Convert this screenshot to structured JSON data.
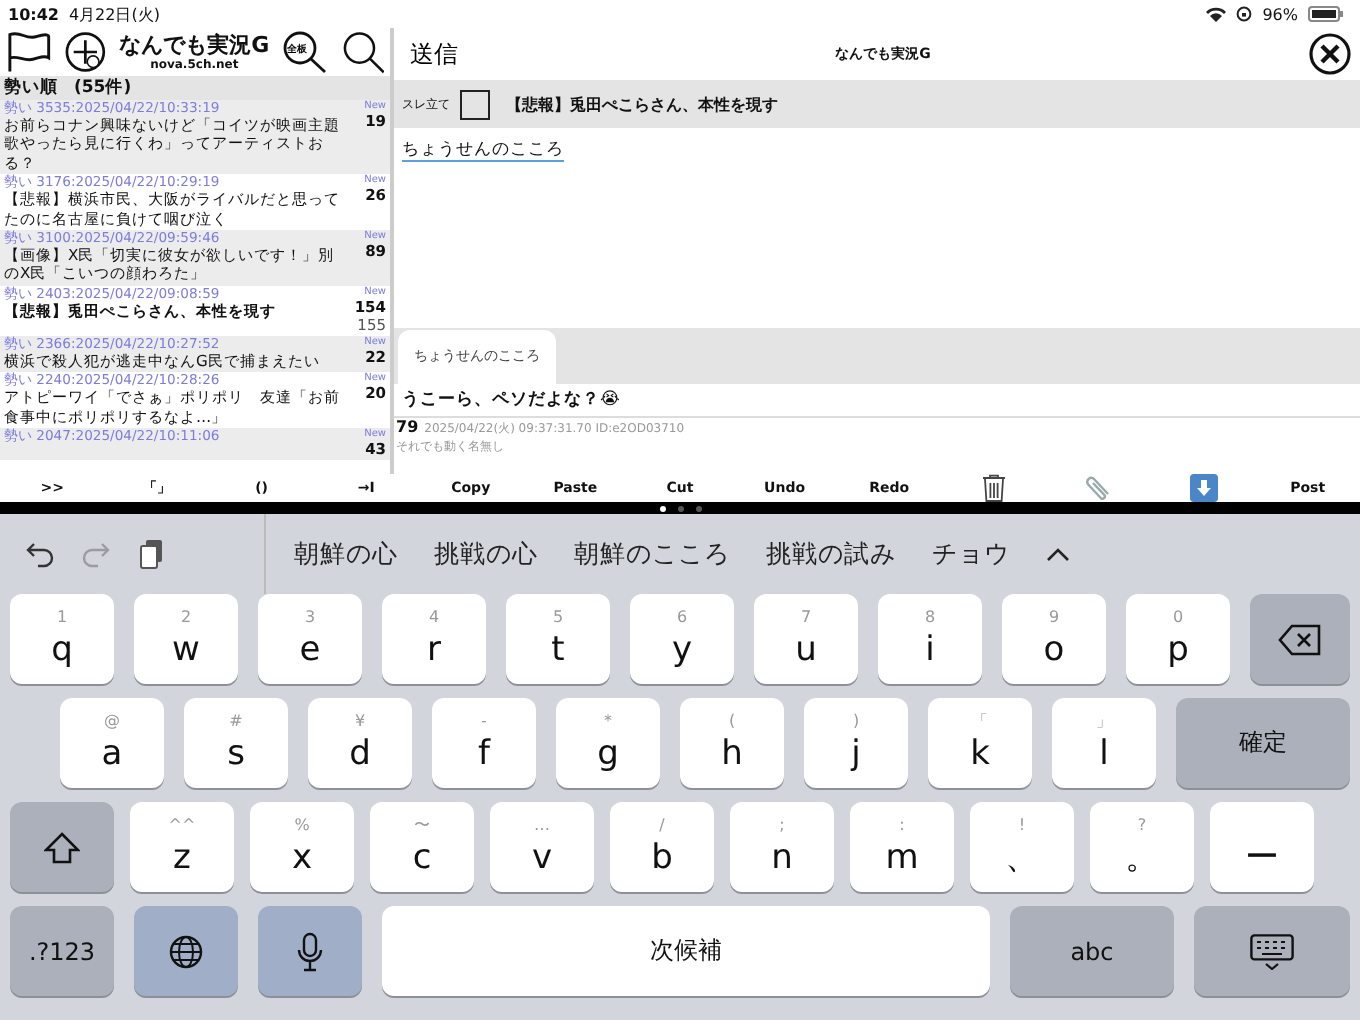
{
  "status_bar": {
    "time": "10:42",
    "date": "4月22日(火)",
    "battery": "96%"
  },
  "thread_list": {
    "board_title": "なんでも実況G",
    "board_host": "nova.5ch.net",
    "search_label": "全板",
    "sort_label": "勢い順",
    "count": "(55件)",
    "threads": [
      {
        "meta": "勢い 3535:2025/04/22/10:33:19",
        "title": "お前らコナン興味ないけど「コイツが映画主題歌やったら見に行くわ」ってアーティストおる？",
        "new_label": "New",
        "count": "19",
        "selected": false
      },
      {
        "meta": "勢い 3176:2025/04/22/10:29:19",
        "title": "【悲報】横浜市民、大阪がライバルだと思ってたのに名古屋に負けて咽び泣く",
        "new_label": "New",
        "count": "26",
        "selected": false
      },
      {
        "meta": "勢い 3100:2025/04/22/09:59:46",
        "title": "【画像】X民「切実に彼女が欲しいです！」別のX民「こいつの顔わろた」",
        "new_label": "New",
        "count": "89",
        "selected": false
      },
      {
        "meta": "勢い 2403:2025/04/22/09:08:59",
        "title": "【悲報】兎田ぺこらさん、本性を現す",
        "new_label": "New",
        "count": "154",
        "total": "155",
        "selected": true
      },
      {
        "meta": "勢い 2366:2025/04/22/10:27:52",
        "title": "横浜で殺人犯が逃走中なんG民で捕まえたい",
        "new_label": "New",
        "count": "22",
        "selected": false
      },
      {
        "meta": "勢い 2240:2025/04/22/10:28:26",
        "title": "アトピーワイ「でさぁ」ポリポリ　友達「お前食事中にポリポリするなよ…」",
        "new_label": "New",
        "count": "20",
        "selected": false
      },
      {
        "meta": "勢い 2047:2025/04/22/10:11:06",
        "new_label": "New",
        "count": "43",
        "selected": false
      }
    ]
  },
  "compose": {
    "send_label": "送信",
    "title": "なんでも実況G",
    "new_thread_label": "スレ立て",
    "new_thread_checked": false,
    "subject": "【悲報】兎田ぺこらさん、本性を現す",
    "body": "ちょうせんのこころ",
    "tab": "ちょうせんのこころ",
    "quote": "うこーら、ペソだよな？😭",
    "post_number": "79",
    "post_meta": "2025/04/22(火) 09:37:31.70 ID:e2OD03710",
    "post_name": "それでも動く名無し"
  },
  "toolbar": [
    {
      "kind": "text",
      "label": ">>"
    },
    {
      "kind": "text",
      "label": "「」"
    },
    {
      "kind": "text",
      "label": "()"
    },
    {
      "kind": "text",
      "label": "→I"
    },
    {
      "kind": "text",
      "label": "Copy"
    },
    {
      "kind": "text",
      "label": "Paste"
    },
    {
      "kind": "text",
      "label": "Cut"
    },
    {
      "kind": "text",
      "label": "Undo"
    },
    {
      "kind": "text",
      "label": "Redo"
    },
    {
      "kind": "trash"
    },
    {
      "kind": "clip"
    },
    {
      "kind": "download"
    },
    {
      "kind": "text",
      "label": "Post"
    }
  ],
  "page_dots": [
    {
      "selected": true
    },
    {
      "selected": false
    },
    {
      "selected": false
    }
  ],
  "keyboard": {
    "tools": [
      {
        "kind": "undo",
        "disabled": false
      },
      {
        "kind": "redo",
        "disabled": true
      },
      {
        "kind": "paste",
        "disabled": false
      }
    ],
    "candidates": [
      "朝鮮の心",
      "挑戦の心",
      "朝鮮のこころ",
      "挑戦の試み",
      "チョウ"
    ],
    "rows": [
      {
        "keys": [
          {
            "kind": "char",
            "label": "q",
            "hint": "1"
          },
          {
            "kind": "char",
            "label": "w",
            "hint": "2"
          },
          {
            "kind": "char",
            "label": "e",
            "hint": "3"
          },
          {
            "kind": "char",
            "label": "r",
            "hint": "4"
          },
          {
            "kind": "char",
            "label": "t",
            "hint": "5"
          },
          {
            "kind": "char",
            "label": "y",
            "hint": "6"
          },
          {
            "kind": "char",
            "label": "u",
            "hint": "7"
          },
          {
            "kind": "char",
            "label": "i",
            "hint": "8"
          },
          {
            "kind": "char",
            "label": "o",
            "hint": "9"
          },
          {
            "kind": "char",
            "label": "p",
            "hint": "0"
          },
          {
            "kind": "backspace"
          }
        ]
      },
      {
        "keys": [
          {
            "kind": "char",
            "label": "a",
            "hint": "@"
          },
          {
            "kind": "char",
            "label": "s",
            "hint": "#"
          },
          {
            "kind": "char",
            "label": "d",
            "hint": "¥"
          },
          {
            "kind": "char",
            "label": "f",
            "hint": "-"
          },
          {
            "kind": "char",
            "label": "g",
            "hint": "*"
          },
          {
            "kind": "char",
            "label": "h",
            "hint": "("
          },
          {
            "kind": "char",
            "label": "j",
            "hint": ")"
          },
          {
            "kind": "char",
            "label": "k",
            "hint": "「"
          },
          {
            "kind": "char",
            "label": "l",
            "hint": "」"
          },
          {
            "kind": "text",
            "label": "確定"
          }
        ]
      },
      {
        "keys": [
          {
            "kind": "shift"
          },
          {
            "kind": "char",
            "label": "z",
            "hint": "^^"
          },
          {
            "kind": "char",
            "label": "x",
            "hint": "%"
          },
          {
            "kind": "char",
            "label": "c",
            "hint": "〜"
          },
          {
            "kind": "char",
            "label": "v",
            "hint": "…"
          },
          {
            "kind": "char",
            "label": "b",
            "hint": "/"
          },
          {
            "kind": "char",
            "label": "n",
            "hint": ";"
          },
          {
            "kind": "char",
            "label": "m",
            "hint": ":"
          },
          {
            "kind": "char",
            "label": "、",
            "hint": "!"
          },
          {
            "kind": "char",
            "label": "。",
            "hint": "?"
          },
          {
            "kind": "char",
            "label": "ー"
          }
        ]
      },
      {
        "keys": [
          {
            "kind": "text",
            "label": ".?123"
          },
          {
            "kind": "globe"
          },
          {
            "kind": "mic"
          },
          {
            "kind": "space",
            "label": "次候補"
          },
          {
            "kind": "text",
            "label": "abc"
          },
          {
            "kind": "hide"
          }
        ]
      }
    ]
  }
}
